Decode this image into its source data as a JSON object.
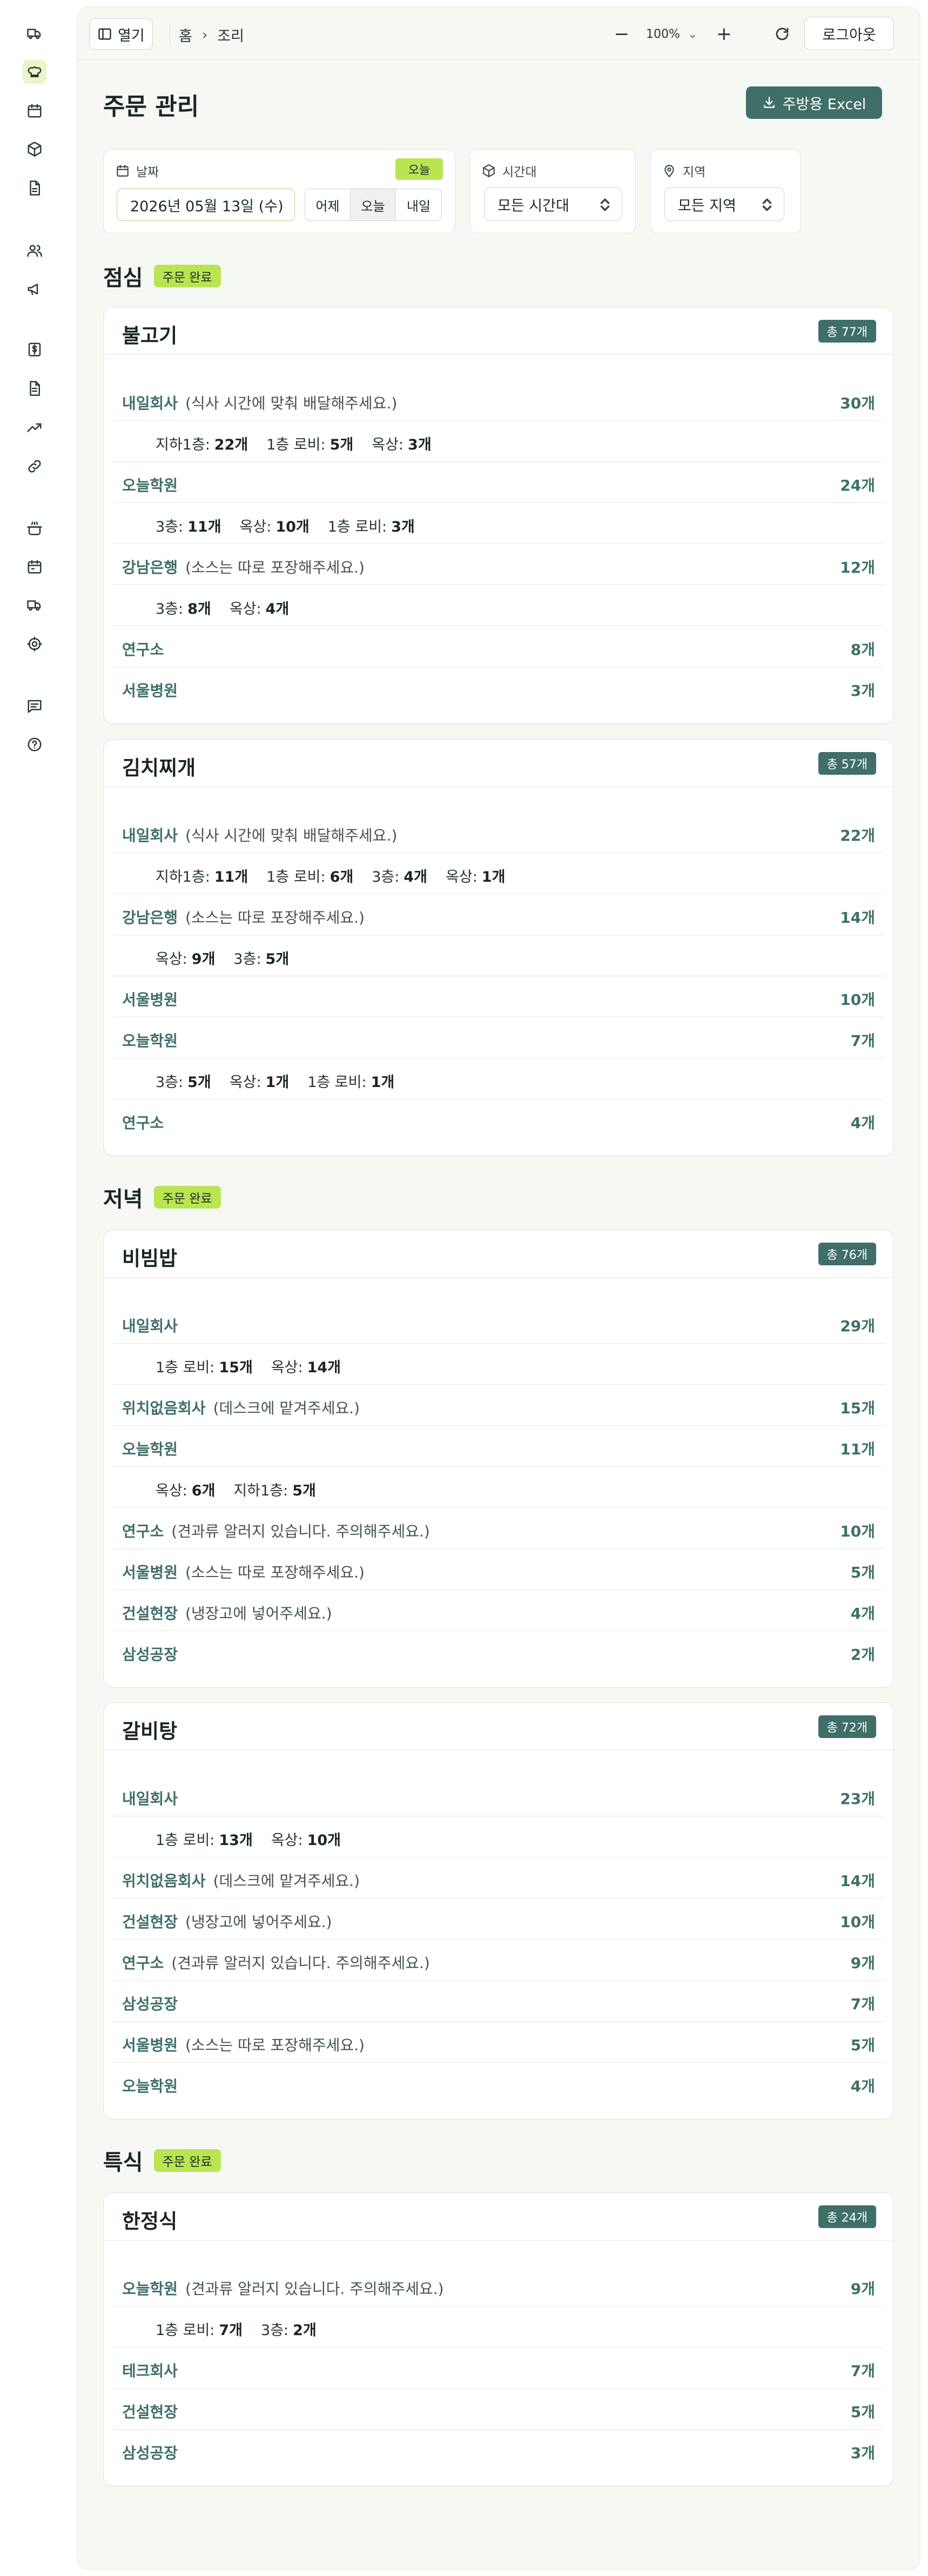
{
  "icons": {
    "rail": [
      "truck-icon",
      "chef-hat-icon",
      "calendar-icon",
      "package-icon",
      "document-icon",
      "users-icon",
      "megaphone-icon",
      "dollar-icon",
      "document-list-icon",
      "trending-icon",
      "link-icon",
      "pot-icon",
      "calendar-check-icon",
      "delivery-icon",
      "settings-icon",
      "chat-icon",
      "help-icon"
    ]
  },
  "topbar": {
    "open_label": "열기",
    "breadcrumb": [
      "홈",
      "조리"
    ],
    "zoom_minus": "−",
    "zoom_level": "100%",
    "zoom_plus": "+",
    "logout_label": "로그아웃"
  },
  "page": {
    "title": "주문 관리",
    "excel_label": "주방용 Excel"
  },
  "filters": {
    "date_label": "날짜",
    "today_badge": "오늘",
    "date_value": "2026년 05월 13일 (수)",
    "quick": [
      "어제",
      "오늘",
      "내일"
    ],
    "time_label": "시간대",
    "time_value": "모든 시간대",
    "region_label": "지역",
    "region_value": "모든 지역"
  },
  "sections": [
    {
      "title": "점심",
      "badge": "주문 완료",
      "cards": [
        {
          "title": "불고기",
          "total": "총 77개",
          "rows": [
            {
              "name": "내일회사",
              "note": "(식사 시간에 맞춰 배달해주세요.)",
              "count": "30개",
              "sub": [
                [
                  "지하1층:",
                  "22개"
                ],
                [
                  "1층 로비:",
                  "5개"
                ],
                [
                  "옥상:",
                  "3개"
                ]
              ]
            },
            {
              "name": "오늘학원",
              "note": "",
              "count": "24개",
              "sub": [
                [
                  "3층:",
                  "11개"
                ],
                [
                  "옥상:",
                  "10개"
                ],
                [
                  "1층 로비:",
                  "3개"
                ]
              ]
            },
            {
              "name": "강남은행",
              "note": "(소스는 따로 포장해주세요.)",
              "count": "12개",
              "sub": [
                [
                  "3층:",
                  "8개"
                ],
                [
                  "옥상:",
                  "4개"
                ]
              ]
            },
            {
              "name": "연구소",
              "note": "",
              "count": "8개",
              "sub": []
            },
            {
              "name": "서울병원",
              "note": "",
              "count": "3개",
              "sub": []
            }
          ]
        },
        {
          "title": "김치찌개",
          "total": "총 57개",
          "rows": [
            {
              "name": "내일회사",
              "note": "(식사 시간에 맞춰 배달해주세요.)",
              "count": "22개",
              "sub": [
                [
                  "지하1층:",
                  "11개"
                ],
                [
                  "1층 로비:",
                  "6개"
                ],
                [
                  "3층:",
                  "4개"
                ],
                [
                  "옥상:",
                  "1개"
                ]
              ]
            },
            {
              "name": "강남은행",
              "note": "(소스는 따로 포장해주세요.)",
              "count": "14개",
              "sub": [
                [
                  "옥상:",
                  "9개"
                ],
                [
                  "3층:",
                  "5개"
                ]
              ]
            },
            {
              "name": "서울병원",
              "note": "",
              "count": "10개",
              "sub": []
            },
            {
              "name": "오늘학원",
              "note": "",
              "count": "7개",
              "sub": [
                [
                  "3층:",
                  "5개"
                ],
                [
                  "옥상:",
                  "1개"
                ],
                [
                  "1층 로비:",
                  "1개"
                ]
              ]
            },
            {
              "name": "연구소",
              "note": "",
              "count": "4개",
              "sub": []
            }
          ]
        }
      ]
    },
    {
      "title": "저녁",
      "badge": "주문 완료",
      "cards": [
        {
          "title": "비빔밥",
          "total": "총 76개",
          "rows": [
            {
              "name": "내일회사",
              "note": "",
              "count": "29개",
              "sub": [
                [
                  "1층 로비:",
                  "15개"
                ],
                [
                  "옥상:",
                  "14개"
                ]
              ]
            },
            {
              "name": "위치없음회사",
              "note": "(데스크에 맡겨주세요.)",
              "count": "15개",
              "sub": []
            },
            {
              "name": "오늘학원",
              "note": "",
              "count": "11개",
              "sub": [
                [
                  "옥상:",
                  "6개"
                ],
                [
                  "지하1층:",
                  "5개"
                ]
              ]
            },
            {
              "name": "연구소",
              "note": "(견과류 알러지 있습니다. 주의해주세요.)",
              "count": "10개",
              "sub": []
            },
            {
              "name": "서울병원",
              "note": "(소스는 따로 포장해주세요.)",
              "count": "5개",
              "sub": []
            },
            {
              "name": "건설현장",
              "note": "(냉장고에 넣어주세요.)",
              "count": "4개",
              "sub": []
            },
            {
              "name": "삼성공장",
              "note": "",
              "count": "2개",
              "sub": []
            }
          ]
        },
        {
          "title": "갈비탕",
          "total": "총 72개",
          "rows": [
            {
              "name": "내일회사",
              "note": "",
              "count": "23개",
              "sub": [
                [
                  "1층 로비:",
                  "13개"
                ],
                [
                  "옥상:",
                  "10개"
                ]
              ]
            },
            {
              "name": "위치없음회사",
              "note": "(데스크에 맡겨주세요.)",
              "count": "14개",
              "sub": []
            },
            {
              "name": "건설현장",
              "note": "(냉장고에 넣어주세요.)",
              "count": "10개",
              "sub": []
            },
            {
              "name": "연구소",
              "note": "(견과류 알러지 있습니다. 주의해주세요.)",
              "count": "9개",
              "sub": []
            },
            {
              "name": "삼성공장",
              "note": "",
              "count": "7개",
              "sub": []
            },
            {
              "name": "서울병원",
              "note": "(소스는 따로 포장해주세요.)",
              "count": "5개",
              "sub": []
            },
            {
              "name": "오늘학원",
              "note": "",
              "count": "4개",
              "sub": []
            }
          ]
        }
      ]
    },
    {
      "title": "특식",
      "badge": "주문 완료",
      "cards": [
        {
          "title": "한정식",
          "total": "총 24개",
          "rows": [
            {
              "name": "오늘학원",
              "note": "(견과류 알러지 있습니다. 주의해주세요.)",
              "count": "9개",
              "sub": [
                [
                  "1층 로비:",
                  "7개"
                ],
                [
                  "3층:",
                  "2개"
                ]
              ]
            },
            {
              "name": "테크회사",
              "note": "",
              "count": "7개",
              "sub": []
            },
            {
              "name": "건설현장",
              "note": "",
              "count": "5개",
              "sub": []
            },
            {
              "name": "삼성공장",
              "note": "",
              "count": "3개",
              "sub": []
            }
          ]
        }
      ]
    }
  ]
}
